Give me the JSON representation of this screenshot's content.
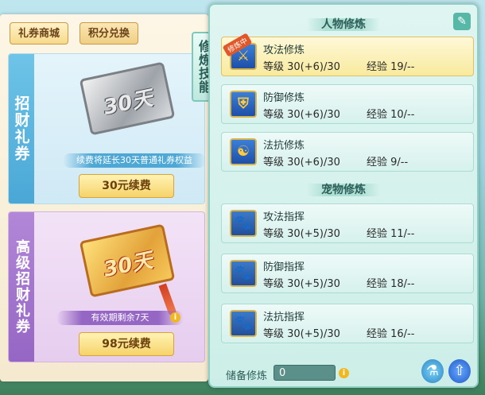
{
  "shop": {
    "tabs": [
      {
        "label": "礼券商城"
      },
      {
        "label": "积分兑换"
      }
    ],
    "cards": [
      {
        "side_label": "招财礼券",
        "coupon_text": "30天",
        "note": "续费将延长30天普通礼券权益",
        "button": "30元续费"
      },
      {
        "side_label": "高级招财礼券",
        "coupon_text": "30天",
        "note": "有效期剩余7天",
        "button": "98元续费"
      }
    ]
  },
  "cultivation": {
    "side_tab": "修炼技能",
    "person_title": "人物修炼",
    "pet_title": "宠物修炼",
    "skills_person": [
      {
        "name": "攻法修炼",
        "level": "等级 30(+6)/30",
        "exp": "经验 19/--",
        "badge": "修炼中",
        "icon": "sword-icon"
      },
      {
        "name": "防御修炼",
        "level": "等级 30(+6)/30",
        "exp": "经验 10/--",
        "icon": "shield-icon"
      },
      {
        "name": "法抗修炼",
        "level": "等级 30(+6)/30",
        "exp": "经验 9/--",
        "icon": "yin-yang-icon"
      }
    ],
    "skills_pet": [
      {
        "name": "攻法指挥",
        "level": "等级 30(+5)/30",
        "exp": "经验 11/--",
        "icon": "paw-sword-icon"
      },
      {
        "name": "防御指挥",
        "level": "等级 30(+5)/30",
        "exp": "经验 18/--",
        "icon": "paw-shield-icon"
      },
      {
        "name": "法抗指挥",
        "level": "等级 30(+5)/30",
        "exp": "经验 16/--",
        "icon": "paw-magic-icon"
      }
    ],
    "storage_label": "储备修炼",
    "storage_value": "0"
  }
}
